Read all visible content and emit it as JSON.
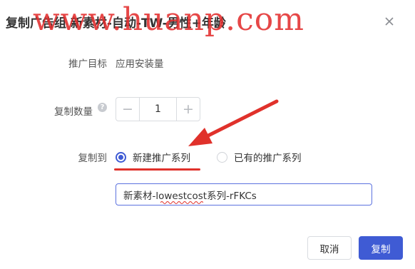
{
  "dialog": {
    "title": "复制广告组 新素材-自动-TW-男性+年龄",
    "watermark": "www.huanp.com"
  },
  "form": {
    "goal_label": "推广目标",
    "goal_value": "应用安装量",
    "quantity_label": "复制数量",
    "quantity_value": "1",
    "quantity_decrement": "−",
    "quantity_increment": "+",
    "help_icon_glyph": "?",
    "copy_to_label": "复制到",
    "options": [
      {
        "label": "新建推广系列",
        "selected": true
      },
      {
        "label": "已有的推广系列",
        "selected": false
      }
    ],
    "series_name_value": "新素材-lowestcost系列-rFKCs"
  },
  "footer": {
    "cancel_label": "取消",
    "confirm_label": "复制"
  },
  "colors": {
    "primary": "#3f5bd4",
    "annotation_red": "#e0312b"
  },
  "icons": [
    "close-icon",
    "help-icon",
    "minus-icon",
    "plus-icon",
    "arrow-annotation"
  ]
}
